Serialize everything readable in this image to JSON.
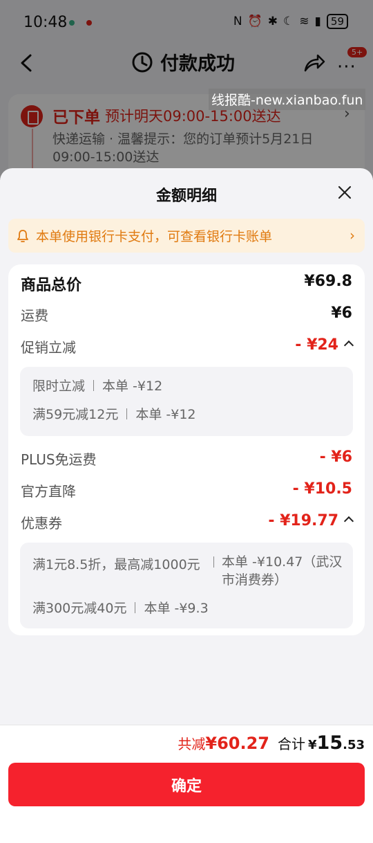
{
  "status_bar": {
    "time": "10:48",
    "icons": [
      "nfc-icon",
      "alarm-icon",
      "bluetooth-icon",
      "moon-icon",
      "wifi-icon",
      "signal-icon"
    ],
    "battery": "59"
  },
  "nav": {
    "title": "付款成功",
    "badge": "5+"
  },
  "watermark": "线报酷-new.xianbao.fun",
  "order": {
    "status": "已下单",
    "eta": "预计明天09:00-15:00送达",
    "note": "快递运输 · 温馨提示：您的订单预计5月21日09:00-15:00送达"
  },
  "sheet": {
    "title": "金额明细",
    "notice": "本单使用银行卡支付，可查看银行卡账单"
  },
  "details": {
    "goods_total_label": "商品总价",
    "goods_total_value": "¥69.8",
    "shipping_label": "运费",
    "shipping_value": "¥6",
    "promo_label": "促销立减",
    "promo_value": "- ¥24",
    "promo_items": [
      {
        "name": "限时立减",
        "amount": "本单 -¥12"
      },
      {
        "name": "满59元减12元",
        "amount": "本单 -¥12"
      }
    ],
    "plus_label": "PLUS免运费",
    "plus_value": "- ¥6",
    "official_label": "官方直降",
    "official_value": "- ¥10.5",
    "coupon_label": "优惠券",
    "coupon_value": "- ¥19.77",
    "coupon_items": [
      {
        "name": "满1元8.5折，最高减1000元",
        "amount": "本单 -¥10.47（武汉市消费券）"
      },
      {
        "name": "满300元减40元",
        "amount": "本单 -¥9.3"
      }
    ]
  },
  "footer": {
    "saved_label": "共减",
    "saved_value": "¥60.27",
    "total_label": "合计",
    "total_currency": "¥",
    "total_int": "15",
    "total_dec": ".53",
    "confirm_label": "确定"
  },
  "colors": {
    "accent_red": "#e2231a",
    "button_red": "#f5222d",
    "notice_bg": "#fdf1de",
    "notice_text": "#e07a10"
  }
}
